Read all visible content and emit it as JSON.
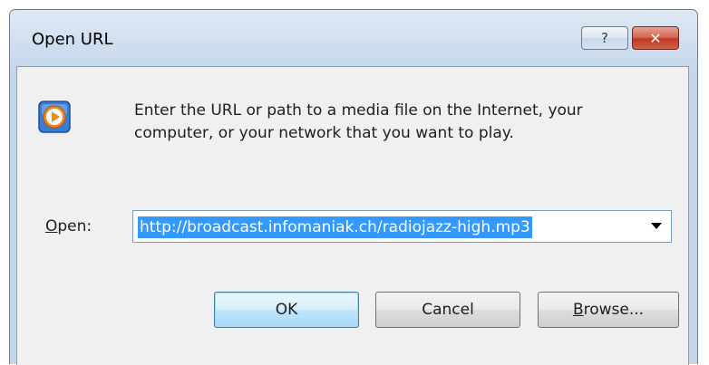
{
  "window": {
    "title": "Open URL",
    "help_label": "?",
    "close_label": "✕"
  },
  "dialog": {
    "prompt": "Enter the URL or path to a media file on the Internet, your computer, or your network that you want to play.",
    "open_label_mnemonic": "O",
    "open_label_rest": "pen:",
    "url_value": "http://broadcast.infomaniak.ch/radiojazz-high.mp3"
  },
  "buttons": {
    "ok": "OK",
    "cancel": "Cancel",
    "browse_mnemonic": "B",
    "browse_rest": "rowse..."
  },
  "colors": {
    "selection": "#3399ff",
    "close": "#c0391f",
    "icon_orange": "#f08a1c",
    "icon_blue": "#3b7bd4"
  }
}
